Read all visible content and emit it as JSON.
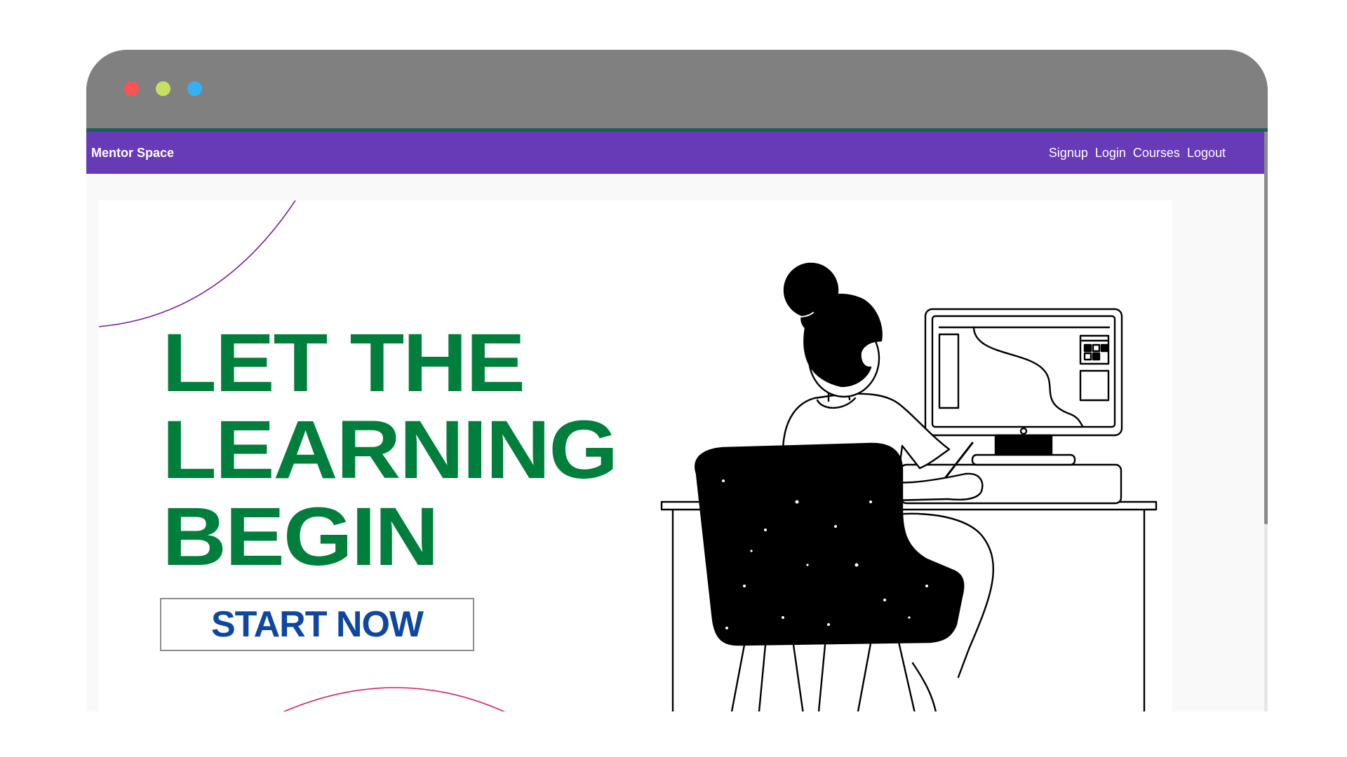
{
  "window": {
    "traffic_lights": [
      {
        "name": "close",
        "color": "#ff5252"
      },
      {
        "name": "minimize",
        "color": "#c6e160"
      },
      {
        "name": "maximize",
        "color": "#34b1f2"
      }
    ]
  },
  "navbar": {
    "brand": "Mentor Space",
    "links": [
      "Signup",
      "Login",
      "Courses",
      "Logout"
    ],
    "background": "#673ab7"
  },
  "hero": {
    "headline_lines": [
      "LET THE",
      "LEARNING",
      "BEGIN"
    ],
    "headline_color": "#007f3c",
    "cta_label": "START NOW",
    "cta_color": "#0d47a1",
    "illustration": "person-at-computer-illustration"
  },
  "colors": {
    "titlebar": "#808080",
    "accent_arc_top": "#7b1fa2",
    "accent_arc_bottom": "#d81b60"
  }
}
